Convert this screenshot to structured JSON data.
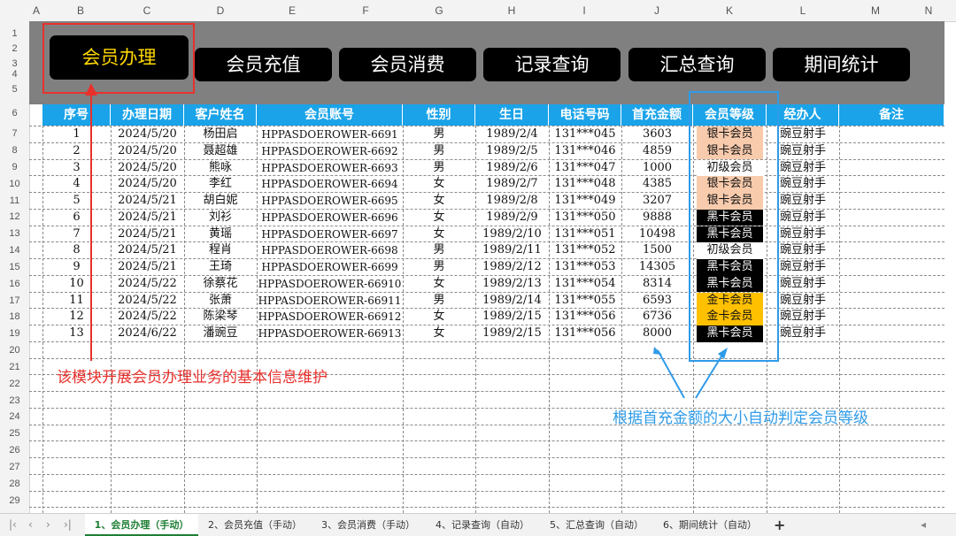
{
  "columns": [
    "A",
    "B",
    "C",
    "D",
    "E",
    "F",
    "G",
    "H",
    "I",
    "J",
    "K",
    "L",
    "M",
    "N"
  ],
  "rows": [
    "1",
    "2",
    "3",
    "4",
    "5",
    "6",
    "7",
    "8",
    "9",
    "10",
    "11",
    "12",
    "13",
    "14",
    "15",
    "16",
    "17",
    "18",
    "19",
    "20",
    "21",
    "22",
    "23",
    "24",
    "25",
    "26",
    "27",
    "28",
    "29"
  ],
  "nav": [
    {
      "label": "会员办理",
      "active": true
    },
    {
      "label": "会员充值",
      "active": false
    },
    {
      "label": "会员消费",
      "active": false
    },
    {
      "label": "记录查询",
      "active": false
    },
    {
      "label": "汇总查询",
      "active": false
    },
    {
      "label": "期间统计",
      "active": false
    }
  ],
  "table": {
    "headers": [
      "序号",
      "办理日期",
      "客户姓名",
      "会员账号",
      "性别",
      "生日",
      "电话号码",
      "首充金额",
      "会员等级",
      "经办人",
      "备注"
    ],
    "rows": [
      [
        "1",
        "2024/5/20",
        "杨田启",
        "HPPASDOEROWER-6691",
        "男",
        "1989/2/4",
        "131***045",
        "3603",
        "银卡会员",
        "豌豆射手",
        ""
      ],
      [
        "2",
        "2024/5/20",
        "聂超雄",
        "HPPASDOEROWER-6692",
        "男",
        "1989/2/5",
        "131***046",
        "4859",
        "银卡会员",
        "豌豆射手",
        ""
      ],
      [
        "3",
        "2024/5/20",
        "熊咏",
        "HPPASDOEROWER-6693",
        "男",
        "1989/2/6",
        "131***047",
        "1000",
        "初级会员",
        "豌豆射手",
        ""
      ],
      [
        "4",
        "2024/5/20",
        "李红",
        "HPPASDOEROWER-6694",
        "女",
        "1989/2/7",
        "131***048",
        "4385",
        "银卡会员",
        "豌豆射手",
        ""
      ],
      [
        "5",
        "2024/5/21",
        "胡白妮",
        "HPPASDOEROWER-6695",
        "女",
        "1989/2/8",
        "131***049",
        "3207",
        "银卡会员",
        "豌豆射手",
        ""
      ],
      [
        "6",
        "2024/5/21",
        "刘衫",
        "HPPASDOEROWER-6696",
        "女",
        "1989/2/9",
        "131***050",
        "9888",
        "黑卡会员",
        "豌豆射手",
        ""
      ],
      [
        "7",
        "2024/5/21",
        "黄瑶",
        "HPPASDOEROWER-6697",
        "女",
        "1989/2/10",
        "131***051",
        "10498",
        "黑卡会员",
        "豌豆射手",
        ""
      ],
      [
        "8",
        "2024/5/21",
        "程肖",
        "HPPASDOEROWER-6698",
        "男",
        "1989/2/11",
        "131***052",
        "1500",
        "初级会员",
        "豌豆射手",
        ""
      ],
      [
        "9",
        "2024/5/21",
        "王琦",
        "HPPASDOEROWER-6699",
        "男",
        "1989/2/12",
        "131***053",
        "14305",
        "黑卡会员",
        "豌豆射手",
        ""
      ],
      [
        "10",
        "2024/5/22",
        "徐蔡花",
        "HPPASDOEROWER-66910",
        "女",
        "1989/2/13",
        "131***054",
        "8314",
        "黑卡会员",
        "豌豆射手",
        ""
      ],
      [
        "11",
        "2024/5/22",
        "张萧",
        "HPPASDOEROWER-66911",
        "男",
        "1989/2/14",
        "131***055",
        "6593",
        "金卡会员",
        "豌豆射手",
        ""
      ],
      [
        "12",
        "2024/5/22",
        "陈梁琴",
        "HPPASDOEROWER-66912",
        "女",
        "1989/2/15",
        "131***056",
        "6736",
        "金卡会员",
        "豌豆射手",
        ""
      ],
      [
        "13",
        "2024/6/22",
        "潘豌豆",
        "HPPASDOEROWER-66913",
        "女",
        "1989/2/15",
        "131***056",
        "8000",
        "黑卡会员",
        "豌豆射手",
        ""
      ]
    ]
  },
  "tier_colors": {
    "银卡会员": "#f8cbad",
    "黑卡会员": "#000000",
    "金卡会员": "#ffc000",
    "初级会员": "#ffffff"
  },
  "annotations": {
    "left": "该模块开展会员办理业务的基本信息维护",
    "right": "根据首充金额的大小自动判定会员等级",
    "left_color": "#e8312d",
    "right_color": "#2f9be8"
  },
  "tabs": [
    {
      "label": "1、会员办理（手动）",
      "active": true
    },
    {
      "label": "2、会员充值（手动）",
      "active": false
    },
    {
      "label": "3、会员消费（手动）",
      "active": false
    },
    {
      "label": "4、记录查询（自动）",
      "active": false
    },
    {
      "label": "5、汇总查询（自动）",
      "active": false
    },
    {
      "label": "6、期间统计（自动）",
      "active": false
    }
  ],
  "add_sheet": "+"
}
